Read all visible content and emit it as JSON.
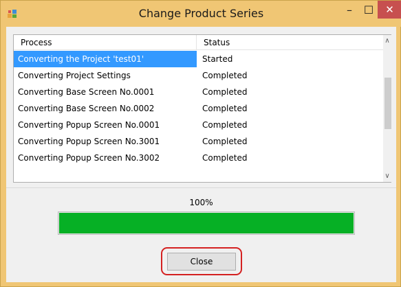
{
  "window": {
    "title": "Change Product Series",
    "controls": {
      "minimize": "–",
      "maximize": "☐",
      "close": "✕"
    }
  },
  "list": {
    "columns": {
      "process": "Process",
      "status": "Status"
    },
    "rows": [
      {
        "process": "Converting the Project 'test01'",
        "status": "Started",
        "selected": true
      },
      {
        "process": "Converting Project Settings",
        "status": "Completed"
      },
      {
        "process": "Converting Base Screen No.0001",
        "status": "Completed"
      },
      {
        "process": "Converting Base Screen No.0002",
        "status": "Completed"
      },
      {
        "process": "Converting Popup Screen No.0001",
        "status": "Completed"
      },
      {
        "process": "Converting Popup Screen No.3001",
        "status": "Completed"
      },
      {
        "process": "Converting Popup Screen No.3002",
        "status": "Completed"
      }
    ],
    "scrollbar": {
      "up": "∧",
      "down": "∨"
    }
  },
  "progress": {
    "label": "100%",
    "value": 1.0,
    "color": "#06b025"
  },
  "buttons": {
    "close_label": "Close"
  },
  "colors": {
    "frame": "#f0c674",
    "selection": "#3399ff",
    "close_highlight": "#d42020",
    "window_close": "#c7504f"
  },
  "icons": {
    "app": "app-icon",
    "minimize": "minimize-icon",
    "maximize": "maximize-icon",
    "close": "close-icon"
  }
}
